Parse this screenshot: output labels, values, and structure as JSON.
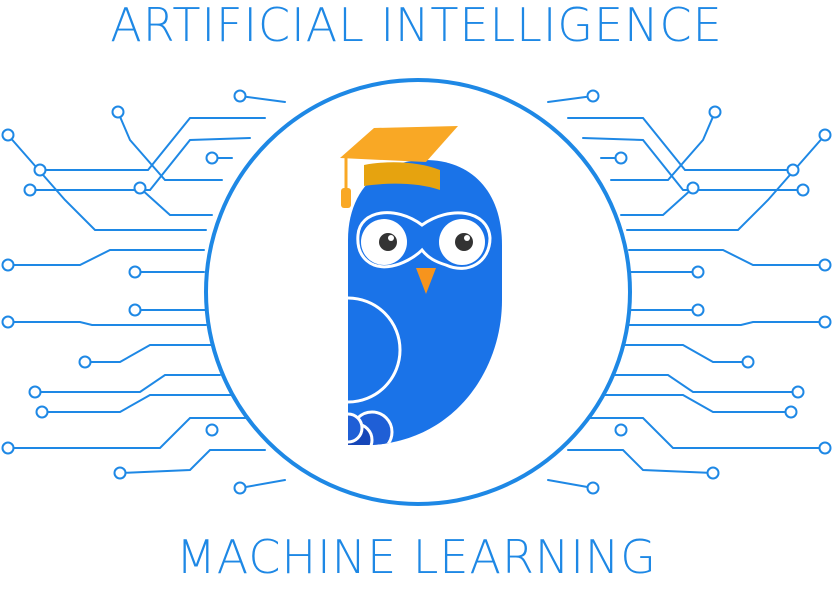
{
  "title_top": "ARTIFICIAL INTELLIGENCE",
  "title_bottom": "MACHINE LEARNING",
  "colors": {
    "primary_blue": "#1e88e5",
    "owl_blue": "#1a73e8",
    "owl_dark_blue": "#1546b8",
    "cap_orange": "#f9a825",
    "beak_orange": "#f7941d",
    "background": "#ffffff"
  },
  "icons": {
    "mascot": "owl-with-graduation-cap-icon",
    "circuit": "circuit-board-lines"
  }
}
